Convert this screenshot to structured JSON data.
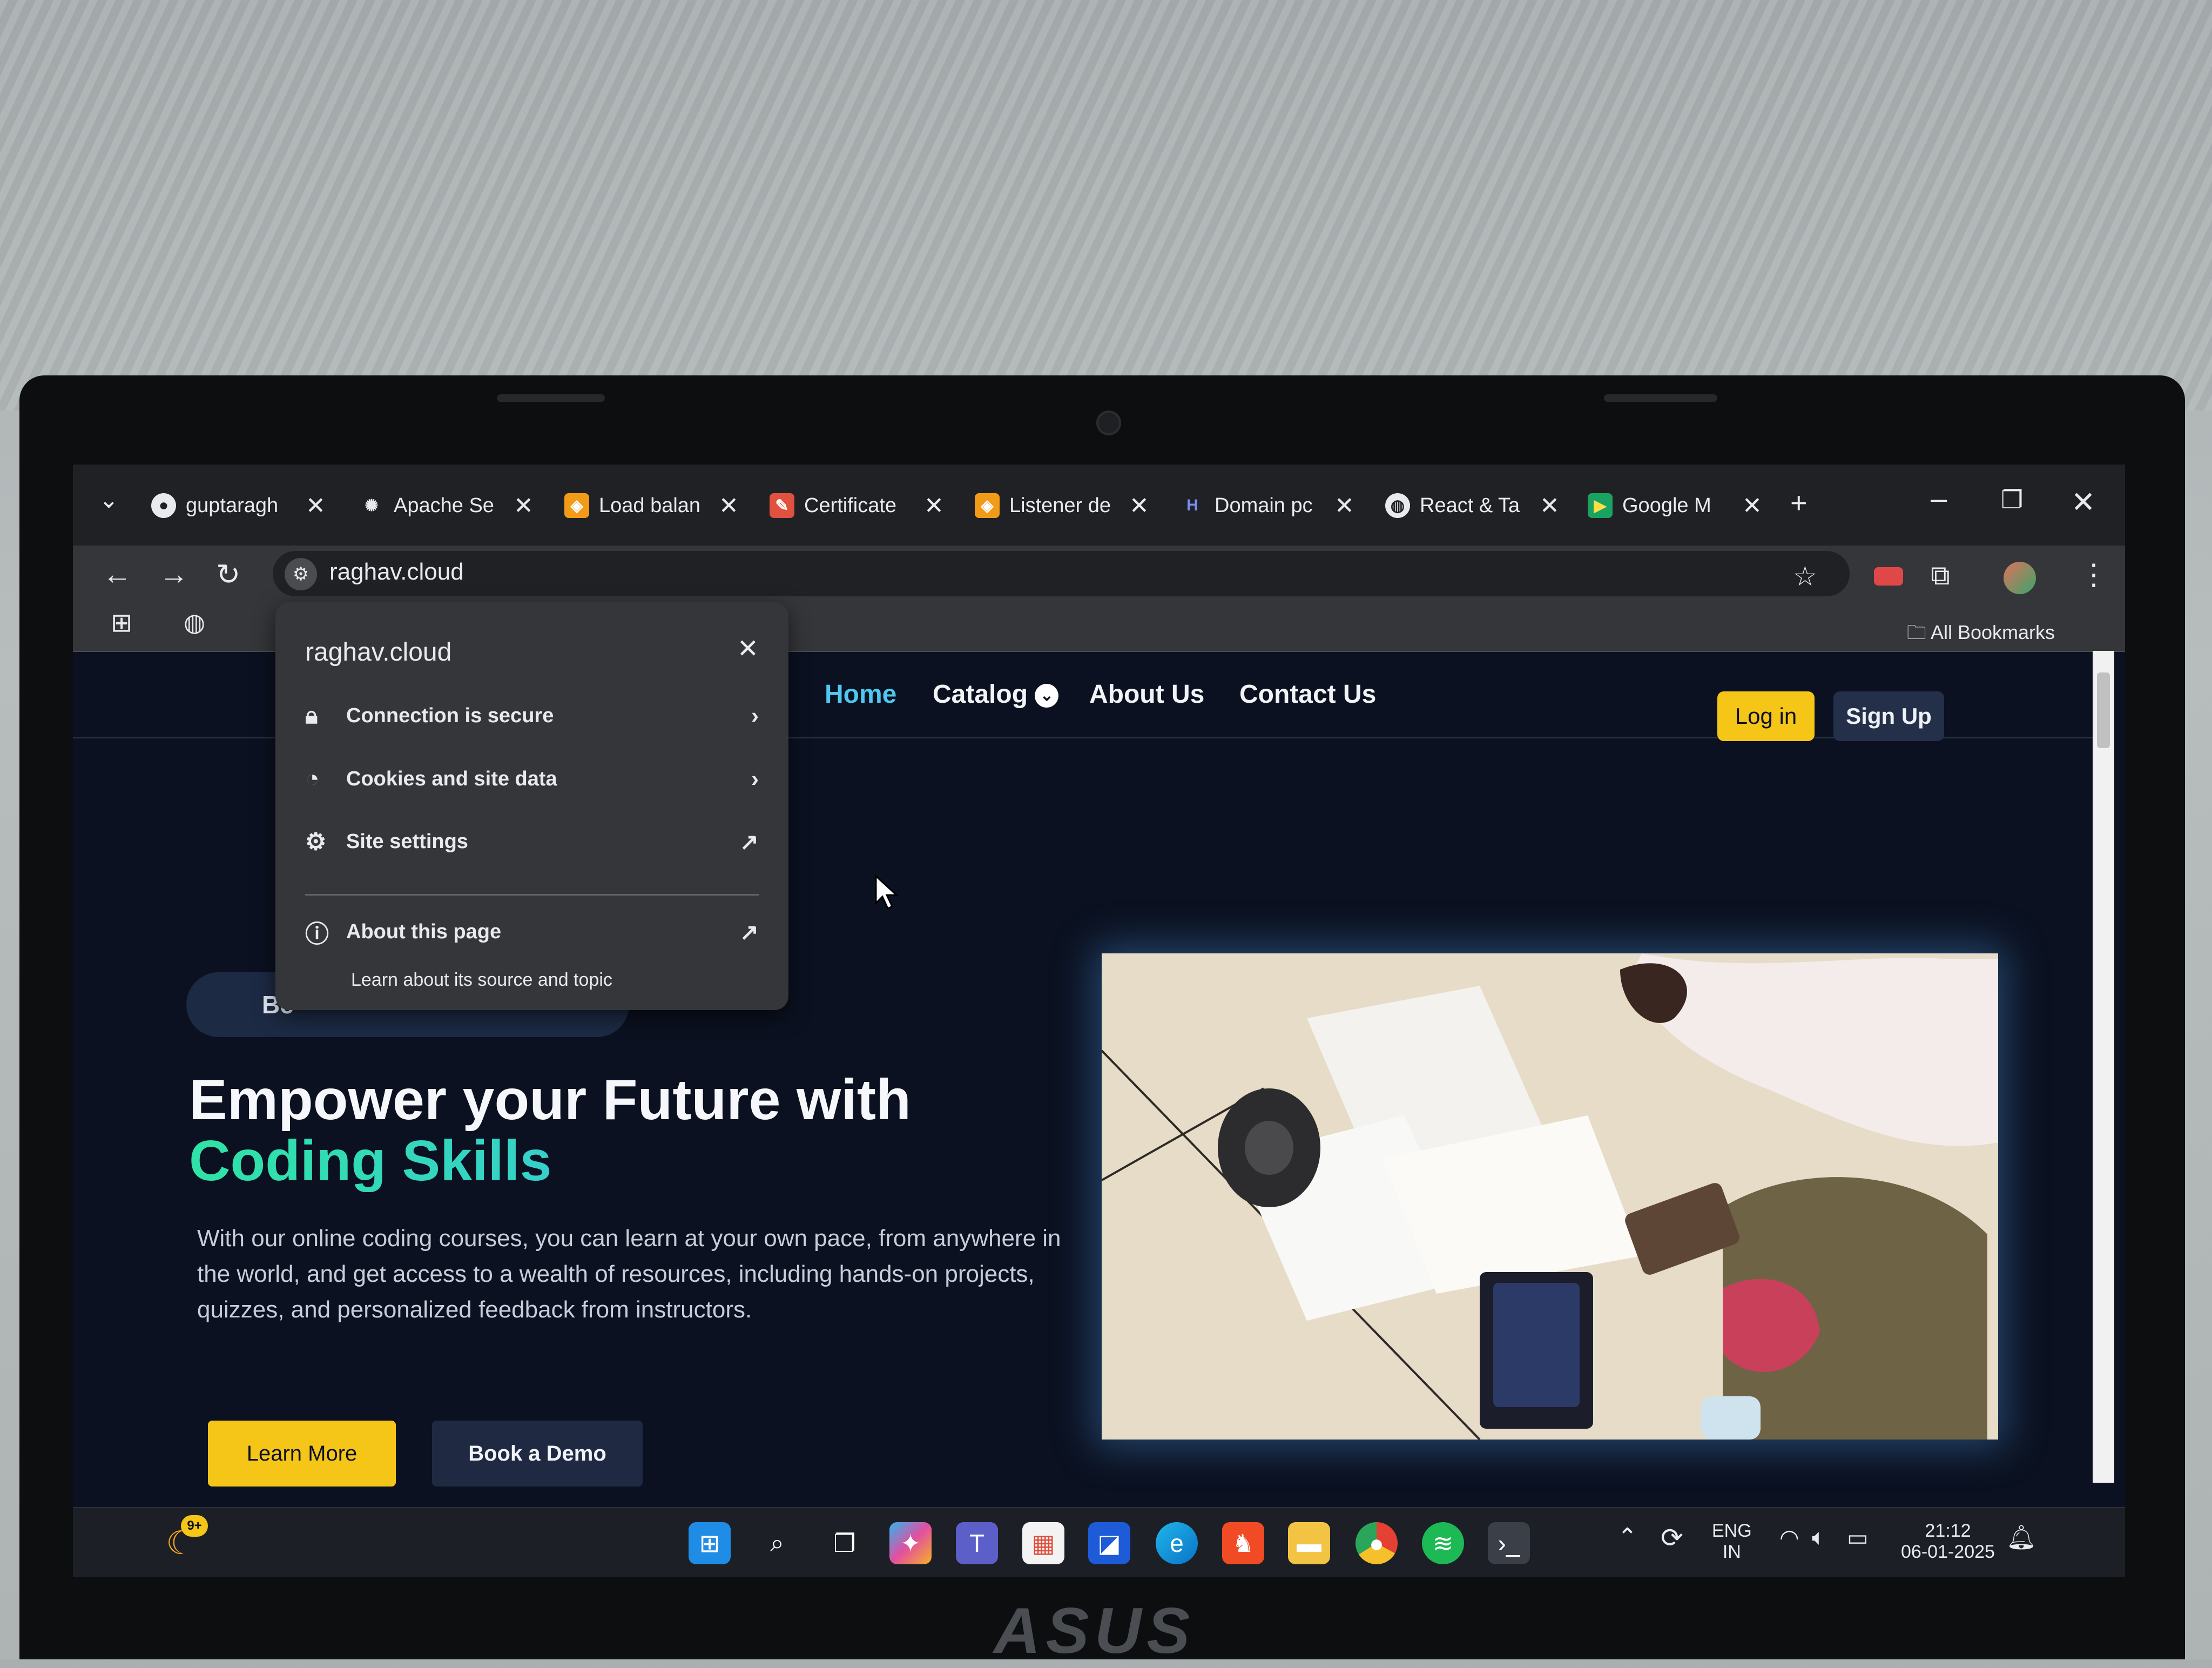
{
  "browser": {
    "tabs": [
      {
        "title": "guptaragh",
        "icon": "github-icon"
      },
      {
        "title": "Apache Se",
        "icon": "openai-icon"
      },
      {
        "title": "Load balan",
        "icon": "aws-icon"
      },
      {
        "title": "Certificate",
        "icon": "aws-cert-icon"
      },
      {
        "title": "Listener de",
        "icon": "aws-icon"
      },
      {
        "title": "Domain pc",
        "icon": "hostinger-icon"
      },
      {
        "title": "React & Ta",
        "icon": "globe-icon"
      },
      {
        "title": "Google M",
        "icon": "google-meet-icon"
      }
    ],
    "url": "raghav.cloud",
    "bookmarks_label": "All Bookmarks"
  },
  "site_info_popup": {
    "title": "raghav.cloud",
    "items": [
      {
        "label": "Connection is secure",
        "icon": "lock-icon"
      },
      {
        "label": "Cookies and site data",
        "icon": "cookie-icon"
      },
      {
        "label": "Site settings",
        "icon": "gear-icon"
      }
    ],
    "about": {
      "label": "About this page",
      "sub": "Learn about its source and topic"
    }
  },
  "site": {
    "nav": {
      "home": "Home",
      "catalog": "Catalog",
      "about": "About Us",
      "contact": "Contact Us"
    },
    "login": "Log in",
    "signup": "Sign Up",
    "instructor_badge": "Be",
    "hero_title_line1": "Empower your Future with",
    "hero_title_line2": "Coding Skills",
    "hero_text": "With our online coding courses, you can learn at your own pace, from anywhere in the world, and get access to a wealth of resources, including hands-on projects, quizzes, and personalized feedback from instructors.",
    "learn_more": "Learn More",
    "book_demo": "Book a Demo"
  },
  "taskbar": {
    "badge": "9+",
    "lang": "ENG",
    "region": "IN",
    "time": "21:12",
    "date": "06-01-2025"
  },
  "device": {
    "brand": "ASUS"
  }
}
